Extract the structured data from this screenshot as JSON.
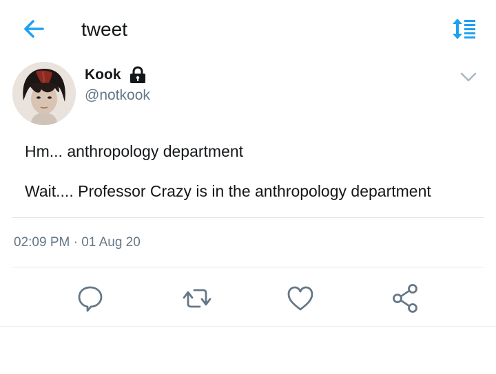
{
  "header": {
    "title": "tweet",
    "back_icon": "arrow-left-icon",
    "sort_icon": "sort-icon",
    "accent_color": "#1da1f2"
  },
  "tweet": {
    "author": {
      "name": "Kook",
      "handle": "@notkook",
      "protected_icon": "lock-icon"
    },
    "text_lines": [
      "Hm... anthropology department",
      "Wait.... Professor Crazy is in the anthropology department"
    ],
    "timestamp": "02:09 PM · 01 Aug 20"
  },
  "actions": [
    {
      "icon": "reply-icon"
    },
    {
      "icon": "retweet-icon"
    },
    {
      "icon": "like-icon"
    },
    {
      "icon": "share-icon"
    }
  ]
}
